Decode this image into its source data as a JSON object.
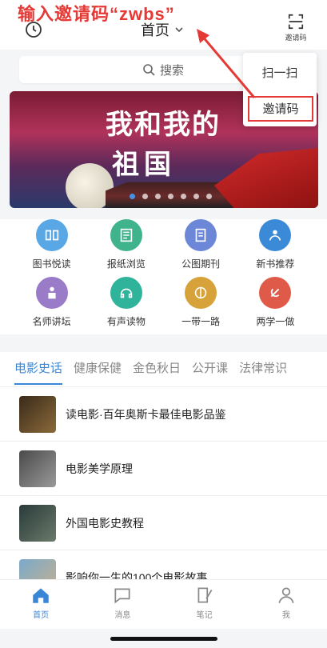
{
  "annotation": "输入邀请码“zwbs”",
  "header": {
    "title": "首页",
    "scan_label": "邀请码"
  },
  "search": {
    "label": "搜索"
  },
  "popup": {
    "items": [
      "扫一扫",
      "邀请码"
    ]
  },
  "banner": {
    "title": "我和我的",
    "subtitle": "祖国",
    "slide_count": 7,
    "active_slide": 1
  },
  "grid": {
    "items": [
      {
        "label": "图书悦读",
        "color": "#5aa7e6"
      },
      {
        "label": "报纸浏览",
        "color": "#3fb38b"
      },
      {
        "label": "公图期刊",
        "color": "#6c86d8"
      },
      {
        "label": "新书推荐",
        "color": "#3a8ad8"
      },
      {
        "label": "名师讲坛",
        "color": "#9a7bc8"
      },
      {
        "label": "有声读物",
        "color": "#2fb39a"
      },
      {
        "label": "一带一路",
        "color": "#d8a23a"
      },
      {
        "label": "两学一做",
        "color": "#e05a4a"
      }
    ]
  },
  "tabs": [
    "电影史话",
    "健康保健",
    "金色秋日",
    "公开课",
    "法律常识"
  ],
  "list": [
    {
      "title": "读电影·百年奥斯卡最佳电影品鉴"
    },
    {
      "title": "电影美学原理"
    },
    {
      "title": "外国电影史教程"
    },
    {
      "title": "影响你一生的100个电影故事"
    }
  ],
  "bottom_nav": [
    {
      "label": "首页",
      "icon": "home-icon"
    },
    {
      "label": "消息",
      "icon": "message-icon"
    },
    {
      "label": "笔记",
      "icon": "note-icon"
    },
    {
      "label": "我",
      "icon": "user-icon"
    }
  ],
  "colors": {
    "accent": "#3a86d6",
    "annotation": "#e53935"
  }
}
